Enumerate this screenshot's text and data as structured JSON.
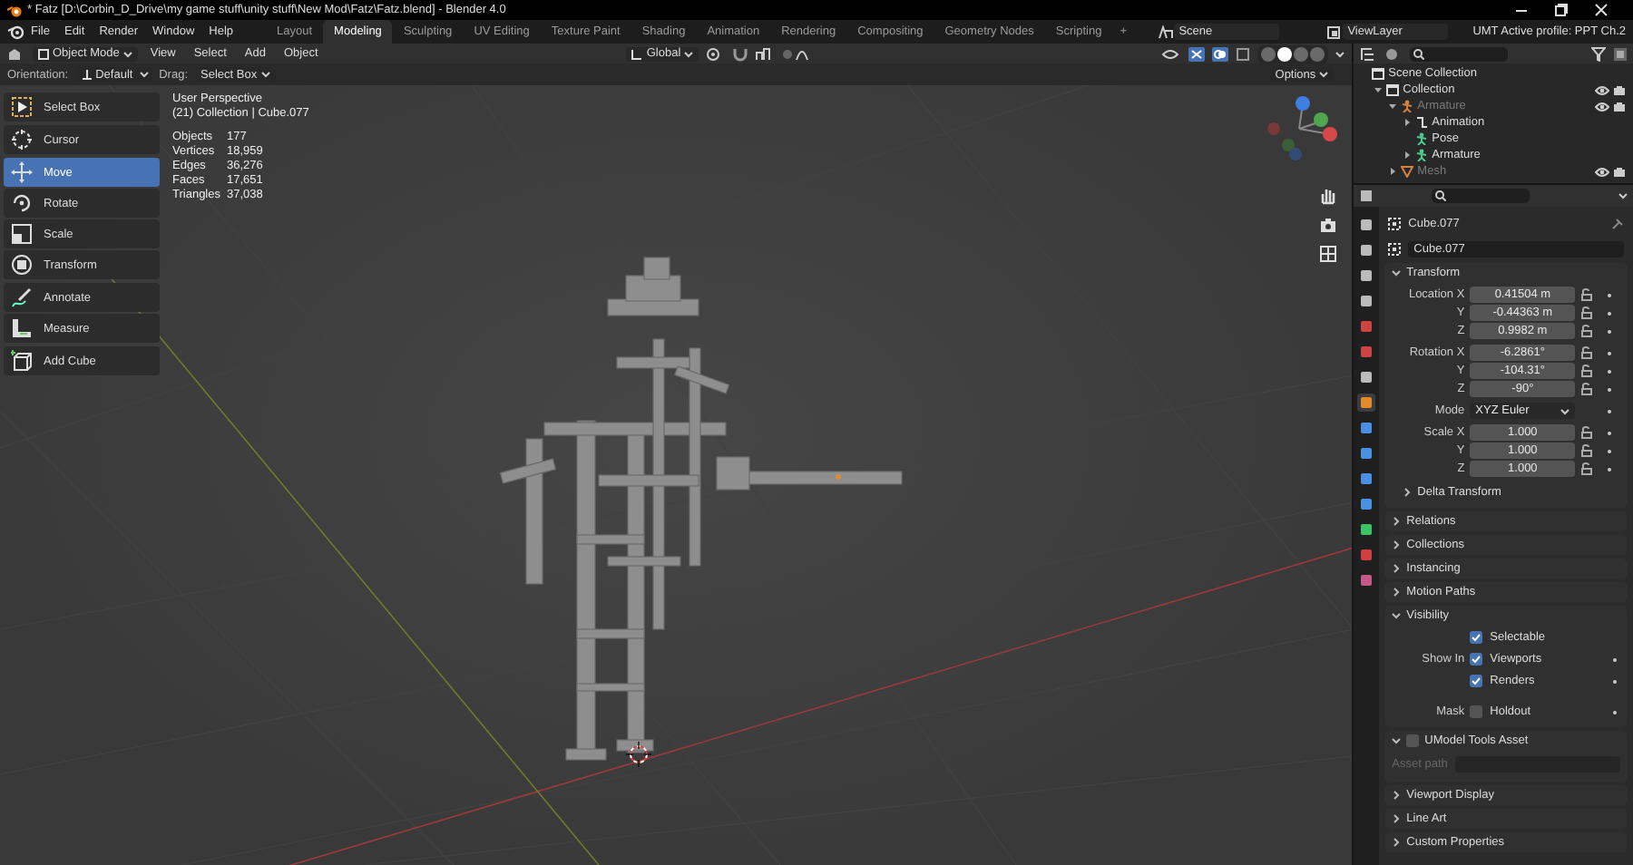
{
  "window": {
    "title": "* Fatz [D:\\Corbin_D_Drive\\my game stuff\\unity stuff\\New Mod\\Fatz\\Fatz.blend] - Blender 4.0"
  },
  "menu": [
    "File",
    "Edit",
    "Render",
    "Window",
    "Help"
  ],
  "workspaces": [
    {
      "label": "Layout",
      "selected": false
    },
    {
      "label": "Modeling",
      "selected": true
    },
    {
      "label": "Sculpting",
      "selected": false
    },
    {
      "label": "UV Editing",
      "selected": false
    },
    {
      "label": "Texture Paint",
      "selected": false
    },
    {
      "label": "Shading",
      "selected": false
    },
    {
      "label": "Animation",
      "selected": false
    },
    {
      "label": "Rendering",
      "selected": false
    },
    {
      "label": "Compositing",
      "selected": false
    },
    {
      "label": "Geometry Nodes",
      "selected": false
    },
    {
      "label": "Scripting",
      "selected": false
    }
  ],
  "add_workspace": "+",
  "scene": {
    "name": "Scene"
  },
  "view_layer": {
    "name": "ViewLayer"
  },
  "profile": "UMT Active profile: PPT Ch.2",
  "viewport_header": {
    "mode": "Object Mode",
    "menus": [
      "View",
      "Select",
      "Add",
      "Object"
    ],
    "orientation": "Global",
    "shading_modes": [
      {
        "selected": false
      },
      {
        "selected": true
      },
      {
        "selected": false
      },
      {
        "selected": false
      }
    ]
  },
  "tool_settings": {
    "orientation_label": "Orientation:",
    "orientation": "Default",
    "drag_label": "Drag:",
    "drag": "Select Box",
    "options": "Options"
  },
  "toolbar": {
    "groups": [
      [
        {
          "label": "Select Box",
          "kind": "select",
          "selected": false
        }
      ],
      [
        {
          "label": "Cursor",
          "kind": "cursor",
          "selected": false
        }
      ],
      [
        {
          "label": "Move",
          "kind": "move",
          "selected": true
        },
        {
          "label": "Rotate",
          "kind": "rotate",
          "selected": false
        },
        {
          "label": "Scale",
          "kind": "scale",
          "selected": false
        },
        {
          "label": "Transform",
          "kind": "transform",
          "selected": false
        }
      ],
      [
        {
          "label": "Annotate",
          "kind": "annotate",
          "selected": false
        },
        {
          "label": "Measure",
          "kind": "measure",
          "selected": false
        }
      ],
      [
        {
          "label": "Add Cube",
          "kind": "add-cube",
          "selected": false
        }
      ]
    ]
  },
  "overlay": {
    "title": "User Perspective",
    "context": "(21) Collection | Cube.077",
    "stats": [
      {
        "label": "Objects",
        "value": "177"
      },
      {
        "label": "Vertices",
        "value": "18,959"
      },
      {
        "label": "Edges",
        "value": "36,276"
      },
      {
        "label": "Faces",
        "value": "17,651"
      },
      {
        "label": "Triangles",
        "value": "37,038"
      }
    ]
  },
  "outliner": {
    "items": [
      {
        "label": "Scene Collection",
        "kind": "scene",
        "dimmed": false,
        "children": [
          {
            "label": "Collection",
            "kind": "collection",
            "dimmed": false,
            "expanded": true,
            "visible": true,
            "children": [
              {
                "label": "Armature",
                "kind": "armature",
                "dimmed": true,
                "expanded": true,
                "visible": true,
                "children": [
                  {
                    "label": "Animation",
                    "kind": "animation",
                    "dimmed": false,
                    "expanded": false
                  },
                  {
                    "label": "Pose",
                    "kind": "pose",
                    "dimmed": false
                  },
                  {
                    "label": "Armature",
                    "kind": "armature-data",
                    "dimmed": false,
                    "expanded": false
                  }
                ]
              },
              {
                "label": "Mesh",
                "kind": "mesh",
                "dimmed": true,
                "expanded": false,
                "visible": true
              }
            ]
          }
        ]
      }
    ]
  },
  "properties": {
    "tabs": [
      {
        "selected": false
      },
      {
        "selected": false
      },
      {
        "selected": false
      },
      {
        "selected": false
      },
      {
        "selected": false
      },
      {
        "selected": false
      },
      {
        "selected": false
      },
      {
        "selected": true
      },
      {
        "selected": false
      },
      {
        "selected": false
      },
      {
        "selected": false
      },
      {
        "selected": false
      },
      {
        "selected": false
      },
      {
        "selected": false
      },
      {
        "selected": false
      }
    ],
    "object_name": "Cube.077",
    "data_name": "Cube.077",
    "panels": [
      {
        "kind": "transform",
        "title": "Transform",
        "expanded": true,
        "groups": [
          {
            "kind": "fields",
            "rows": [
              {
                "label": "Location X",
                "value": "0.41504 m"
              },
              {
                "label": "Y",
                "value": "-0.44363 m"
              },
              {
                "label": "Z",
                "value": "0.9982 m"
              }
            ]
          },
          {
            "kind": "fields",
            "rows": [
              {
                "label": "Rotation X",
                "value": "-6.2861°"
              },
              {
                "label": "Y",
                "value": "-104.31°"
              },
              {
                "label": "Z",
                "value": "-90°"
              }
            ]
          },
          {
            "kind": "dropdown",
            "label": "Mode",
            "value": "XYZ Euler"
          },
          {
            "kind": "fields",
            "rows": [
              {
                "label": "Scale X",
                "value": "1.000"
              },
              {
                "label": "Y",
                "value": "1.000"
              },
              {
                "label": "Z",
                "value": "1.000"
              }
            ]
          }
        ],
        "subpanels": [
          {
            "title": "Delta Transform",
            "expanded": false
          }
        ]
      },
      {
        "kind": "plain",
        "title": "Relations",
        "expanded": false
      },
      {
        "kind": "plain",
        "title": "Collections",
        "expanded": false
      },
      {
        "kind": "plain",
        "title": "Instancing",
        "expanded": false
      },
      {
        "kind": "plain",
        "title": "Motion Paths",
        "expanded": false
      },
      {
        "kind": "visibility",
        "title": "Visibility",
        "expanded": true,
        "rows": [
          {
            "checkbox": "Selectable",
            "checked": true,
            "keyframe": false
          },
          {
            "label": "Show In",
            "checkbox": "Viewports",
            "checked": true,
            "keyframe": true
          },
          {
            "checkbox": "Renders",
            "checked": true,
            "keyframe": true
          },
          {
            "label": "Mask",
            "checkbox": "Holdout",
            "checked": false,
            "keyframe": true
          }
        ]
      },
      {
        "kind": "addon",
        "title": "UModel Tools Asset",
        "expanded": true,
        "checked": false,
        "field_label": "Asset path",
        "disabled": true
      },
      {
        "kind": "plain",
        "title": "Viewport Display",
        "expanded": false
      },
      {
        "kind": "plain",
        "title": "Line Art",
        "expanded": false
      },
      {
        "kind": "plain",
        "title": "Custom Properties",
        "expanded": false
      }
    ]
  }
}
